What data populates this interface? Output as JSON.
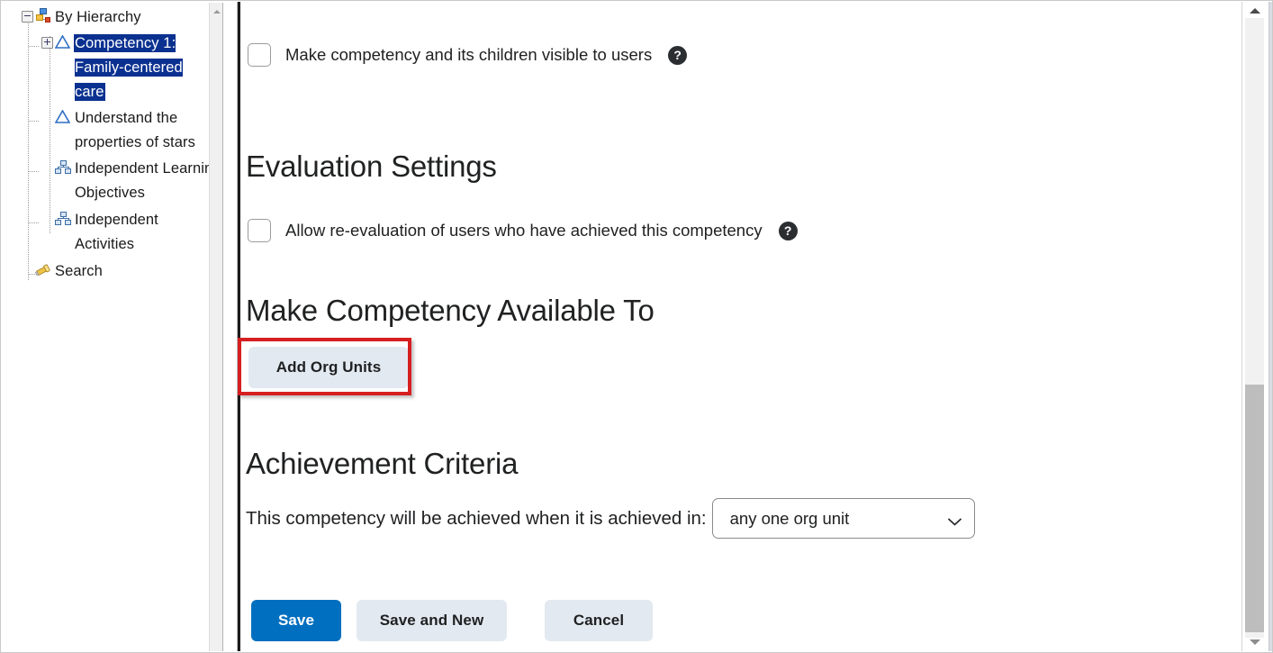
{
  "tree": {
    "root": {
      "label": "By Hierarchy",
      "icon": "hierarchy-icon",
      "expander": "minus"
    },
    "items": [
      {
        "label": "Competency 1: Family-centered care",
        "icon": "competency-triangle-icon",
        "expander": "plus",
        "selected": true
      },
      {
        "label": "Understand the properties of stars",
        "icon": "competency-triangle-icon",
        "expander": "none",
        "selected": false
      },
      {
        "label": "Independent Learning Objectives",
        "icon": "learning-objective-icon",
        "expander": "none",
        "selected": false
      },
      {
        "label": "Independent Activities",
        "icon": "learning-objective-icon",
        "expander": "none",
        "selected": false
      },
      {
        "label": "Search",
        "icon": "flashlight-search-icon",
        "expander": "none",
        "selected": false
      }
    ]
  },
  "main": {
    "visibility": {
      "checkbox_label": "Make competency and its children visible to users",
      "checked": false,
      "help_icon": "help-circle-icon",
      "help_glyph": "?"
    },
    "evaluation": {
      "heading": "Evaluation Settings",
      "checkbox_label": "Allow re-evaluation of users who have achieved this competency",
      "checked": false,
      "help_icon": "help-circle-icon",
      "help_glyph": "?"
    },
    "availability": {
      "heading": "Make Competency Available To",
      "add_org_units_label": "Add Org Units"
    },
    "achievement": {
      "heading": "Achievement Criteria",
      "prompt": "This competency will be achieved when it is achieved in:",
      "select_value": "any one org unit",
      "select_options": [
        "any one org unit"
      ],
      "chevron_icon": "chevron-down-icon"
    },
    "actions": {
      "save": "Save",
      "save_and_new": "Save and New",
      "cancel": "Cancel"
    }
  },
  "colors": {
    "primary_button": "#006fbf",
    "secondary_button": "#e3e9f0",
    "annotation_highlight": "#d61f20",
    "tree_selection": "#0b3190"
  },
  "scrollbars": {
    "left_up_arrow": "scroll-up-arrow",
    "right_up_arrow": "scroll-up-arrow",
    "right_down_arrow": "scroll-down-arrow"
  }
}
